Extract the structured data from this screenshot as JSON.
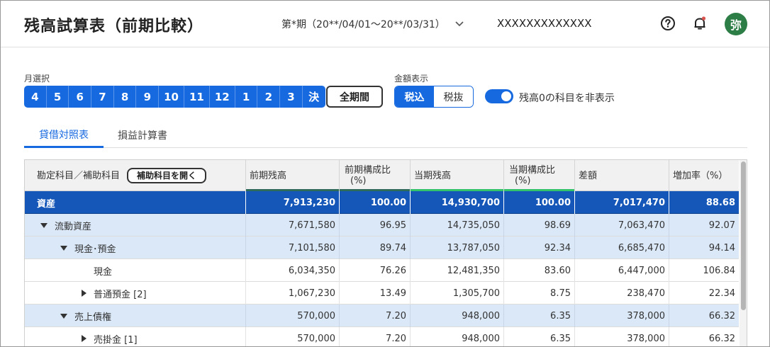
{
  "header": {
    "title": "残高試算表（前期比較）",
    "period": "第*期（20**/04/01〜20**/03/31）",
    "company": "XXXXXXXXXXXXX",
    "avatar_text": "弥",
    "icons": [
      "help-circle-icon",
      "bell-icon"
    ]
  },
  "filters": {
    "month_label": "月選択",
    "months": [
      "4",
      "5",
      "6",
      "7",
      "8",
      "9",
      "10",
      "11",
      "12",
      "1",
      "2",
      "3",
      "決"
    ],
    "all_period": "全期間",
    "amount_label": "金額表示",
    "tax_included": "税込",
    "tax_excluded": "税抜",
    "tax_selected": "税込",
    "hide_zero_toggle": true,
    "hide_zero_label": "残高0の科目を非表示"
  },
  "tabs": [
    {
      "label": "貸借対照表",
      "active": true
    },
    {
      "label": "損益計算書",
      "active": false
    }
  ],
  "table": {
    "columns": {
      "account": "勘定科目／補助科目",
      "open_sub": "補助科目を開く",
      "prev_balance": "前期残高",
      "prev_ratio_1": "前期構成比",
      "prev_ratio_2": "(%)",
      "curr_balance": "当期残高",
      "curr_ratio_1": "当期構成比",
      "curr_ratio_2": "(%)",
      "diff": "差額",
      "rate": "増加率（%）"
    },
    "colors": {
      "prev_indicator": "#2e6b5a",
      "curr_indicator": "#34c26b",
      "section_header": "#1457b8",
      "group_band": "#dbe8f8"
    },
    "rows": [
      {
        "name": "資産",
        "level": 0,
        "toggle": "",
        "style": "head",
        "prev": "7,913,230",
        "prev_ratio": "100.00",
        "curr": "14,930,700",
        "curr_ratio": "100.00",
        "diff": "7,017,470",
        "rate": "88.68"
      },
      {
        "name": "流動資産",
        "level": 1,
        "toggle": "down",
        "style": "band",
        "prev": "7,671,580",
        "prev_ratio": "96.95",
        "curr": "14,735,050",
        "curr_ratio": "98.69",
        "diff": "7,063,470",
        "rate": "92.07"
      },
      {
        "name": "現金･預金",
        "level": 2,
        "toggle": "down",
        "style": "band",
        "prev": "7,101,580",
        "prev_ratio": "89.74",
        "curr": "13,787,050",
        "curr_ratio": "92.34",
        "diff": "6,685,470",
        "rate": "94.14"
      },
      {
        "name": "現金",
        "level": 3,
        "toggle": "",
        "style": "plain",
        "prev": "6,034,350",
        "prev_ratio": "76.26",
        "curr": "12,481,350",
        "curr_ratio": "83.60",
        "diff": "6,447,000",
        "rate": "106.84"
      },
      {
        "name": "普通預金 [2]",
        "level": 3,
        "toggle": "right",
        "style": "plain",
        "prev": "1,067,230",
        "prev_ratio": "13.49",
        "curr": "1,305,700",
        "curr_ratio": "8.75",
        "diff": "238,470",
        "rate": "22.34"
      },
      {
        "name": "売上債権",
        "level": 2,
        "toggle": "down",
        "style": "band",
        "prev": "570,000",
        "prev_ratio": "7.20",
        "curr": "948,000",
        "curr_ratio": "6.35",
        "diff": "378,000",
        "rate": "66.32"
      },
      {
        "name": "売掛金 [1]",
        "level": 3,
        "toggle": "right",
        "style": "plain",
        "prev": "570,000",
        "prev_ratio": "7.20",
        "curr": "948,000",
        "curr_ratio": "6.35",
        "diff": "378,000",
        "rate": "66.32"
      }
    ]
  }
}
